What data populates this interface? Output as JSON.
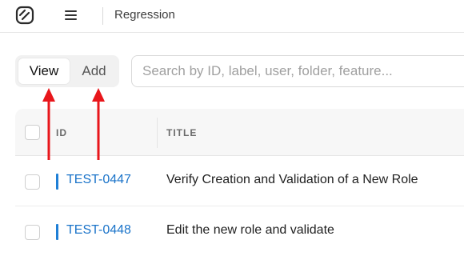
{
  "header": {
    "breadcrumb": "Regression",
    "logo_icon": "app-logo-icon",
    "menu_icon": "hamburger-menu-icon"
  },
  "toggle": {
    "view_label": "View",
    "add_label": "Add",
    "selected": "View"
  },
  "search": {
    "placeholder": "Search by ID, label, user, folder, feature...",
    "value": ""
  },
  "table": {
    "columns": [
      "ID",
      "TITLE"
    ],
    "rows": [
      {
        "id": "TEST-0447",
        "title": "Verify Creation and Validation of a New Role"
      },
      {
        "id": "TEST-0448",
        "title": "Edit the new role and validate"
      }
    ]
  },
  "annotations": {
    "arrow_color": "#e8161b"
  },
  "colors": {
    "link": "#1a73c9",
    "accent_bar": "#1f7fd6",
    "header_bg": "#f7f7f7"
  }
}
